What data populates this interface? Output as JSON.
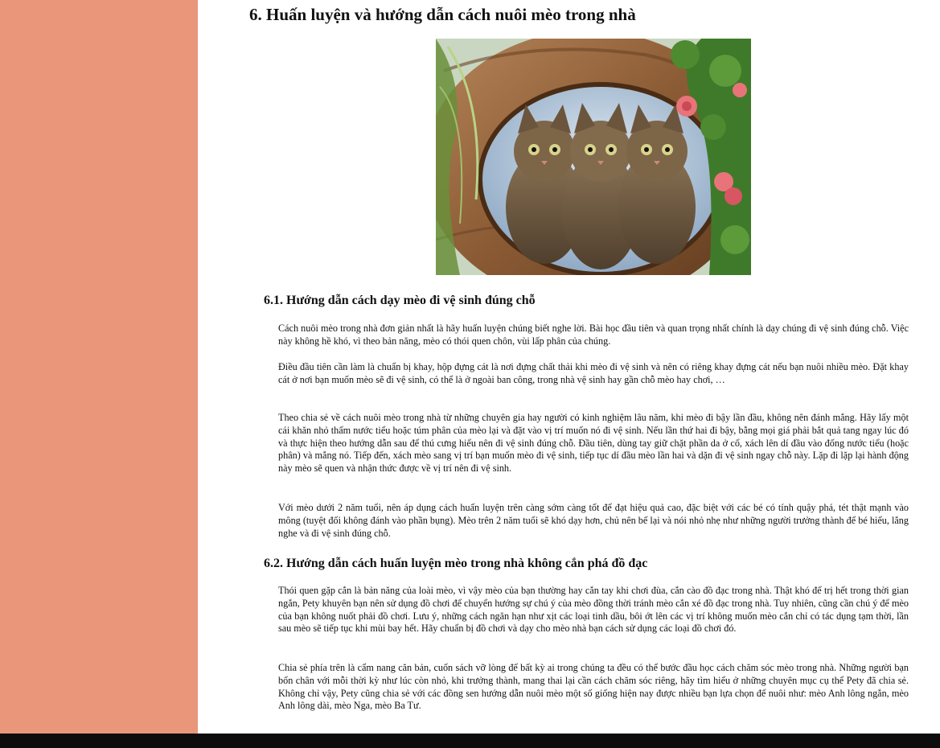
{
  "colors": {
    "sidebar": "#e9967a",
    "content_background": "#ffffff",
    "bottom_bar": "#0d0d0d",
    "text": "#111111"
  },
  "article": {
    "heading": "6. Huấn luyện và hướng dẫn cách nuôi mèo trong nhà",
    "hero_image": {
      "description_icon": "three-kittens-in-log-photo"
    },
    "sections": [
      {
        "title": "6.1. Hướng dẫn cách dạy mèo đi vệ sinh đúng chỗ",
        "paragraphs": [
          "Cách nuôi mèo trong nhà đơn giản nhất là hãy huấn luyện chúng biết nghe lời. Bài học đầu tiên và quan trọng nhất chính là dạy chúng đi vệ sinh đúng chỗ. Việc này không hề khó, vì theo bản năng, mèo có thói quen chôn, vùi lấp phân của chúng.",
          "Điều đầu tiên cần làm là chuẩn bị khay, hộp đựng cát là nơi đựng chất thải khi mèo đi vệ sinh và nên có riêng khay đựng cát nếu bạn nuôi nhiều mèo. Đặt khay cát ở nơi bạn muốn mèo sẽ đi vệ sinh, có thể là ở ngoài ban công, trong nhà vệ sinh hay gần chỗ mèo hay chơi, …",
          "Theo chia sẻ về cách nuôi mèo trong nhà từ những chuyên gia hay người có kinh nghiệm lâu năm, khi mèo đi bậy lần đầu, không nên đánh mắng. Hãy lấy một cái khăn nhỏ thấm nước tiểu hoặc túm phân của mèo lại và đặt vào vị trí muốn nó đi vệ sinh. Nếu lần thứ hai đi bậy, bằng mọi giá phải bắt quả tang ngay lúc đó và thực hiện theo hướng dẫn sau để thú cưng hiểu nên đi vệ sinh đúng chỗ. Đầu tiên, dùng tay giữ chặt phần da ở cổ, xách lên dí đầu vào đống nước tiểu (hoặc phân) và mắng nó. Tiếp đến, xách mèo sang vị trí bạn muốn mèo đi vệ sinh, tiếp tục dí đầu mèo lần hai và dặn đi vệ sinh ngay chỗ này. Lặp đi lặp lại hành động này mèo sẽ quen và nhận thức được về vị trí nên đi vệ sinh.",
          "Với mèo dưới 2 năm tuổi, nên áp dụng cách huấn luyện trên càng sớm càng tốt để đạt hiệu quả cao, đặc biệt với các bé có tính quậy phá, tét thật mạnh vào mông (tuyệt đối không đánh vào phần bụng). Mèo trên 2 năm tuổi sẽ khó dạy hơn, chủ nên bế lại và nói nhỏ nhẹ như những người trưởng thành để bé hiểu, lắng nghe và đi vệ sinh đúng chỗ."
        ]
      },
      {
        "title": "6.2. Hướng dẫn cách huấn luyện mèo trong nhà không cắn phá đồ đạc",
        "paragraphs": [
          "Thói quen gặp cắn là bản năng của loài mèo, vì vậy mèo của bạn thường hay cắn tay khi chơi đùa, cắn cào đồ đạc trong nhà. Thật khó để trị hết trong thời gian ngắn, Pety khuyên bạn nên sử dụng đồ chơi để chuyển hướng sự chú ý của mèo đồng thời tránh mèo cắn xé đồ đạc trong nhà. Tuy nhiên, cũng cần chú ý để mèo của bạn không nuốt phải đồ chơi. Lưu ý, những cách ngăn hạn như xịt các loại tinh dầu, bôi ớt lên các vị trí không muốn mèo cắn chỉ có tác dụng tạm thời, lần sau mèo sẽ tiếp tục khi mùi bay hết. Hãy chuẩn bị đồ chơi và dạy cho mèo nhà bạn cách sử dụng các loại đồ chơi đó.",
          "Chia sẻ phía trên là cẩm nang căn bản, cuốn sách vỡ lòng để bất kỳ ai trong chúng ta đều có thể bước đầu học cách chăm sóc mèo trong nhà. Những người bạn bốn chân với mỗi thời kỳ như lúc còn nhỏ, khi trưởng thành, mang thai lại cần cách chăm sóc riêng, hãy tìm hiểu ở những chuyên mục cụ thể Pety đã chia sẻ. Không chỉ vậy, Pety cũng chia sẻ với các đồng sen hướng dẫn nuôi mèo một số giống hiện nay được nhiều bạn lựa chọn để nuôi như: mèo Anh lông ngắn, mèo Anh lông dài, mèo Nga, mèo Ba Tư."
        ]
      }
    ]
  }
}
